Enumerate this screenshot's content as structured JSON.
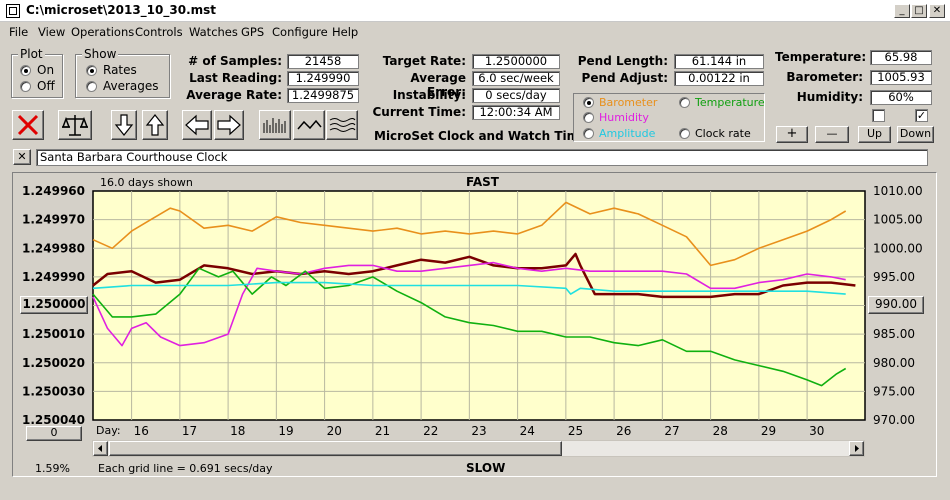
{
  "window": {
    "title": "C:\\microset\\2013_10_30.mst",
    "min": "_",
    "max": "□",
    "close": "✕"
  },
  "menu": [
    "File",
    "View",
    "Operations",
    "Controls",
    "Watches",
    "GPS",
    "Configure",
    "Help"
  ],
  "plot_group": {
    "caption": "Plot",
    "on": "On",
    "off": "Off",
    "selected": "On"
  },
  "show_group": {
    "caption": "Show",
    "rates": "Rates",
    "averages": "Averages",
    "selected": "Rates"
  },
  "stats": {
    "samples_label": "# of Samples:",
    "samples": "21458",
    "last_label": "Last Reading:",
    "last": "1.249990",
    "avg_label": "Average Rate:",
    "avg": "1.2499875"
  },
  "rates": {
    "target_label": "Target Rate:",
    "target": "1.2500000",
    "avgerr_label": "Average Error:",
    "avgerr": "6.0 sec/week",
    "instab_label": "Instability:",
    "instab": "0 secs/day",
    "time_label": "Current Time:",
    "time": "12:00:34 AM",
    "app_name": "MicroSet Clock and Watch Timer"
  },
  "pend": {
    "length_label": "Pend Length:",
    "length": "61.144 in",
    "adjust_label": "Pend Adjust:",
    "adjust": "0.00122 in"
  },
  "env": {
    "temp_label": "Temperature:",
    "temp": "65.98",
    "baro_label": "Barometer:",
    "baro": "1005.93",
    "hum_label": "Humidity:",
    "hum": "60%"
  },
  "series_select": {
    "barometer": "Barometer",
    "temperature": "Temperature",
    "humidity": "Humidity",
    "amplitude": "Amplitude",
    "clock_rate": "Clock rate",
    "selected": "Barometer"
  },
  "adjust_buttons": {
    "plus": "+",
    "minus": "—",
    "up": "Up",
    "down": "Down"
  },
  "clock_name": "Santa Barbara Courthouse Clock",
  "clear_x": "✕",
  "chart_data": {
    "type": "line",
    "top_label": "FAST",
    "bottom_label": "SLOW",
    "days_shown": "16.0 days shown",
    "x_label": "Day:",
    "x_ticks": [
      "16",
      "17",
      "18",
      "19",
      "20",
      "21",
      "22",
      "23",
      "24",
      "25",
      "26",
      "27",
      "28",
      "29",
      "30"
    ],
    "xlim": [
      15.2,
      31.2
    ],
    "left_ticks": [
      "1.249960",
      "1.249970",
      "1.249980",
      "1.249990",
      "1.250000",
      "1.250010",
      "1.250020",
      "1.250030",
      "1.250040"
    ],
    "left_center": "1.250000",
    "ylim_left": [
      1.25004,
      1.24996
    ],
    "right_ticks": [
      "1010.00",
      "1005.00",
      "1000.00",
      "995.00",
      "990.00",
      "985.00",
      "980.00",
      "975.00",
      "970.00"
    ],
    "right_center": "990.00",
    "ylim_right": [
      970,
      1010
    ],
    "grid_note": "Each grid line = 0.691 secs/day",
    "percent": "1.59%",
    "zero_button": "0",
    "colors": {
      "clock_rate": "#7a0000",
      "barometer": "#e8901c",
      "humidity": "#e020e0",
      "temperature": "#10b010",
      "amplitude": "#20e0e0"
    },
    "series": [
      {
        "key": "clock_rate",
        "axis": "left",
        "x": [
          15.2,
          15.5,
          16.0,
          16.5,
          17.0,
          17.5,
          18.0,
          18.5,
          19.0,
          19.5,
          20.0,
          20.5,
          21.0,
          21.5,
          22.0,
          22.5,
          23.0,
          23.5,
          24.0,
          24.5,
          25.0,
          25.2,
          25.3,
          25.6,
          26.0,
          26.5,
          27.0,
          27.5,
          28.0,
          28.5,
          29.0,
          29.5,
          30.0,
          30.5,
          31.0
        ],
        "y": [
          1.249993,
          1.249989,
          1.249988,
          1.249992,
          1.249991,
          1.249986,
          1.249987,
          1.249989,
          1.249988,
          1.249989,
          1.249988,
          1.249989,
          1.249988,
          1.249986,
          1.249984,
          1.249985,
          1.249983,
          1.249986,
          1.249987,
          1.249987,
          1.249986,
          1.249982,
          1.249986,
          1.249996,
          1.249996,
          1.249996,
          1.249997,
          1.249997,
          1.249997,
          1.249996,
          1.249996,
          1.249993,
          1.249992,
          1.249992,
          1.249993
        ]
      },
      {
        "key": "barometer",
        "axis": "right",
        "x": [
          15.2,
          15.6,
          16.0,
          16.4,
          16.8,
          17.0,
          17.5,
          18.0,
          18.5,
          19.0,
          19.5,
          20.0,
          20.5,
          21.0,
          21.5,
          22.0,
          22.5,
          23.0,
          23.5,
          24.0,
          24.5,
          25.0,
          25.5,
          26.0,
          26.5,
          27.0,
          27.5,
          28.0,
          28.5,
          29.0,
          29.5,
          30.0,
          30.5,
          30.8
        ],
        "y": [
          1001.5,
          1000,
          1003,
          1005,
          1007,
          1006.5,
          1003.5,
          1004,
          1003,
          1005.5,
          1004.5,
          1004,
          1003.5,
          1003,
          1003.5,
          1002.5,
          1003,
          1002.5,
          1003,
          1002.5,
          1004,
          1008,
          1006,
          1007,
          1006,
          1004,
          1002,
          997,
          998,
          1000,
          1001.5,
          1003,
          1005,
          1006.5
        ]
      },
      {
        "key": "humidity",
        "axis": "left",
        "x": [
          15.2,
          15.5,
          15.8,
          16.0,
          16.3,
          16.6,
          17.0,
          17.5,
          18.0,
          18.3,
          18.6,
          19.0,
          19.5,
          20.0,
          20.5,
          21.0,
          21.5,
          22.0,
          22.5,
          23.0,
          23.5,
          24.0,
          24.5,
          25.0,
          25.5,
          26.0,
          26.5,
          27.0,
          27.5,
          28.0,
          28.5,
          29.0,
          29.5,
          30.0,
          30.5,
          30.8
        ],
        "y": [
          1.249997,
          1.250008,
          1.250014,
          1.250008,
          1.250006,
          1.250011,
          1.250014,
          1.250013,
          1.25001,
          1.249996,
          1.249987,
          1.249988,
          1.249989,
          1.249987,
          1.249986,
          1.249986,
          1.249988,
          1.249988,
          1.249987,
          1.249986,
          1.249985,
          1.249987,
          1.249988,
          1.249987,
          1.249988,
          1.249988,
          1.249988,
          1.249988,
          1.249989,
          1.249994,
          1.249994,
          1.249992,
          1.249991,
          1.249989,
          1.24999,
          1.249991
        ]
      },
      {
        "key": "temperature",
        "axis": "left",
        "x": [
          15.2,
          15.6,
          16.0,
          16.5,
          17.0,
          17.4,
          17.8,
          18.1,
          18.5,
          18.9,
          19.2,
          19.6,
          20.0,
          20.5,
          21.0,
          21.5,
          22.0,
          22.5,
          23.0,
          23.5,
          24.0,
          24.5,
          25.0,
          25.5,
          26.0,
          26.5,
          27.0,
          27.5,
          28.0,
          28.5,
          29.0,
          29.5,
          30.0,
          30.3,
          30.6,
          30.8
        ],
        "y": [
          1.249996,
          1.250004,
          1.250004,
          1.250003,
          1.249996,
          1.249987,
          1.24999,
          1.249988,
          1.249996,
          1.24999,
          1.249993,
          1.249988,
          1.249994,
          1.249993,
          1.24999,
          1.249995,
          1.249999,
          1.250004,
          1.250006,
          1.250007,
          1.250009,
          1.250009,
          1.250011,
          1.250011,
          1.250013,
          1.250014,
          1.250012,
          1.250016,
          1.250016,
          1.250019,
          1.250021,
          1.250023,
          1.250026,
          1.250028,
          1.250024,
          1.250022
        ]
      },
      {
        "key": "amplitude",
        "axis": "left",
        "x": [
          15.2,
          16.0,
          17.0,
          18.0,
          19.0,
          20.0,
          21.0,
          22.0,
          23.0,
          24.0,
          25.0,
          25.1,
          25.3,
          26.0,
          27.0,
          28.0,
          29.0,
          30.0,
          30.8
        ],
        "y": [
          1.249994,
          1.249993,
          1.249993,
          1.249993,
          1.249992,
          1.249992,
          1.249993,
          1.249993,
          1.249993,
          1.249993,
          1.249994,
          1.249996,
          1.249994,
          1.249995,
          1.249995,
          1.249995,
          1.249995,
          1.249995,
          1.249996
        ]
      }
    ]
  }
}
